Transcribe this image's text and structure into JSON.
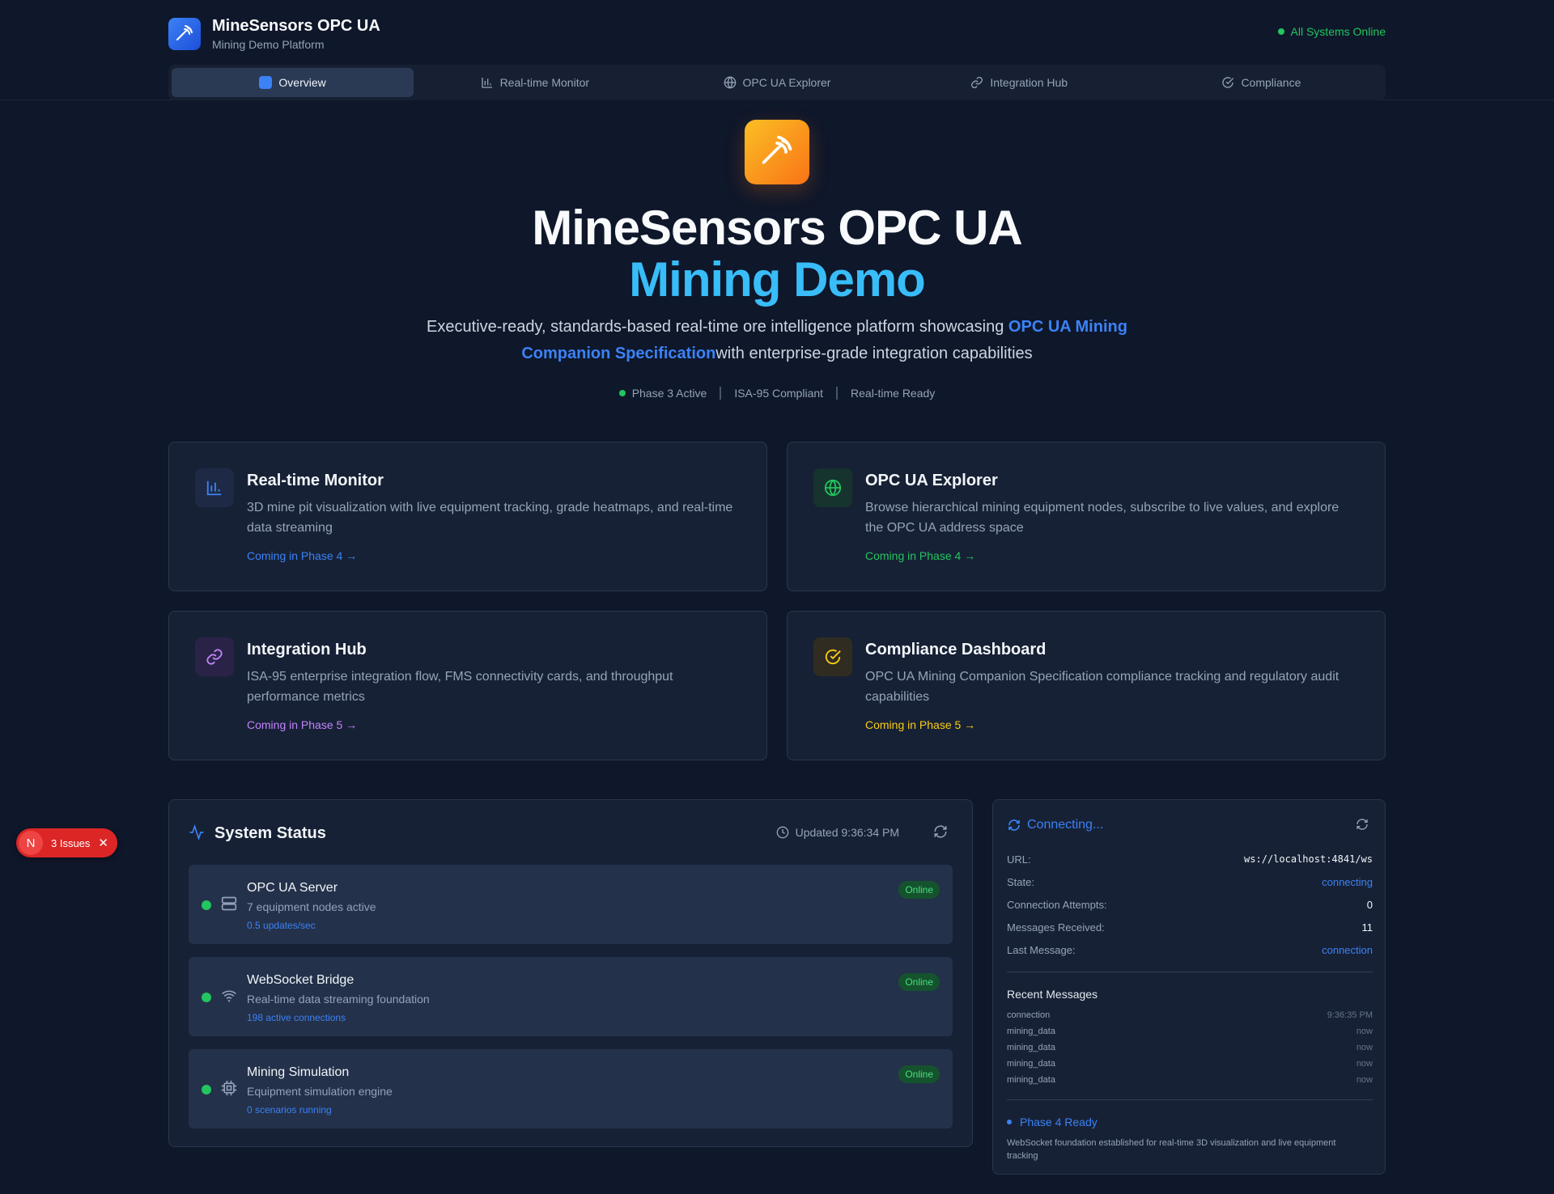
{
  "brand": {
    "title": "MineSensors OPC UA",
    "subtitle": "Mining Demo Platform"
  },
  "status_indicator": "All Systems Online",
  "nav": {
    "tabs": [
      {
        "label": "Overview",
        "active": true
      },
      {
        "label": "Real-time Monitor"
      },
      {
        "label": "OPC UA Explorer"
      },
      {
        "label": "Integration Hub"
      },
      {
        "label": "Compliance"
      }
    ]
  },
  "hero": {
    "title_line1": "MineSensors OPC UA",
    "title_line2": "Mining Demo",
    "desc_prefix": "Executive-ready, standards-based real-time ore intelligence platform showcasing ",
    "desc_highlight": "OPC UA Mining Companion Specification",
    "desc_suffix": "with enterprise-grade integration capabilities",
    "badges": [
      "Phase 3 Active",
      "ISA-95 Compliant",
      "Real-time Ready"
    ]
  },
  "features": [
    {
      "title": "Real-time Monitor",
      "desc": "3D mine pit visualization with live equipment tracking, grade heatmaps, and real-time data streaming",
      "link": "Coming in Phase 4 →",
      "color": "#3b82f6"
    },
    {
      "title": "OPC UA Explorer",
      "desc": "Browse hierarchical mining equipment nodes, subscribe to live values, and explore the OPC UA address space",
      "link": "Coming in Phase 4 →",
      "color": "#22c55e"
    },
    {
      "title": "Integration Hub",
      "desc": "ISA-95 enterprise integration flow, FMS connectivity cards, and throughput performance metrics",
      "link": "Coming in Phase 5 →",
      "color": "#c084fc"
    },
    {
      "title": "Compliance Dashboard",
      "desc": "OPC UA Mining Companion Specification compliance tracking and regulatory audit capabilities",
      "link": "Coming in Phase 5 →",
      "color": "#facc15"
    }
  ],
  "system_status": {
    "title": "System Status",
    "updated": "Updated 9:36:34 PM",
    "services": [
      {
        "name": "OPC UA Server",
        "desc": "7 equipment nodes active",
        "metric": "0.5 updates/sec",
        "status": "Online",
        "icon": "server-icon"
      },
      {
        "name": "WebSocket Bridge",
        "desc": "Real-time data streaming foundation",
        "metric": "198 active connections",
        "status": "Online",
        "icon": "wifi-icon"
      },
      {
        "name": "Mining Simulation",
        "desc": "Equipment simulation engine",
        "metric": "0 scenarios running",
        "status": "Online",
        "icon": "cpu-icon"
      }
    ]
  },
  "connection": {
    "heading": "Connecting...",
    "rows": [
      {
        "key": "URL:",
        "value": "ws://localhost:4841/ws"
      },
      {
        "key": "State:",
        "value": "connecting"
      },
      {
        "key": "Connection Attempts:",
        "value": "0"
      },
      {
        "key": "Messages Received:",
        "value": "11"
      },
      {
        "key": "Last Message:",
        "value": "connection"
      }
    ],
    "recent_title": "Recent Messages",
    "messages": [
      {
        "type": "connection",
        "time": "9:36:35 PM"
      },
      {
        "type": "mining_data",
        "time": "now"
      },
      {
        "type": "mining_data",
        "time": "now"
      },
      {
        "type": "mining_data",
        "time": "now"
      },
      {
        "type": "mining_data",
        "time": "now"
      }
    ],
    "phase_ready": "Phase 4 Ready",
    "phase_note": "WebSocket foundation established for real-time 3D visualization and live equipment tracking"
  },
  "issues_badge": {
    "initial": "N",
    "label": "3 Issues",
    "close": "✕"
  }
}
